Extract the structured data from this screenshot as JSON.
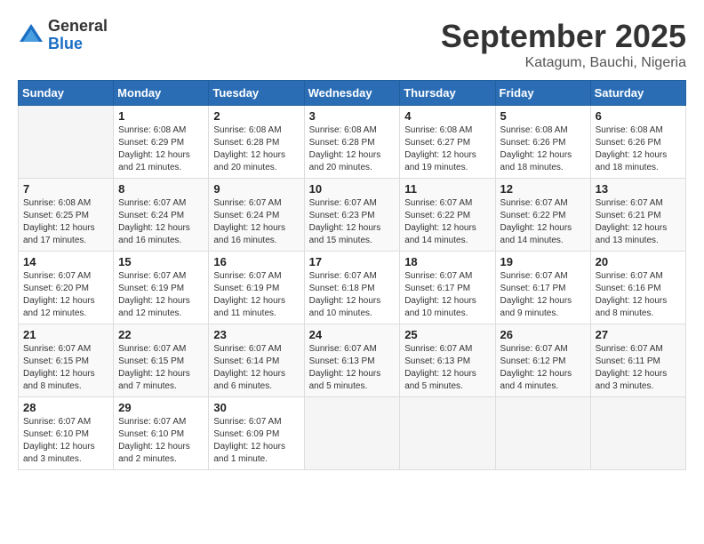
{
  "logo": {
    "general": "General",
    "blue": "Blue"
  },
  "header": {
    "month_title": "September 2025",
    "location": "Katagum, Bauchi, Nigeria"
  },
  "days_of_week": [
    "Sunday",
    "Monday",
    "Tuesday",
    "Wednesday",
    "Thursday",
    "Friday",
    "Saturday"
  ],
  "weeks": [
    [
      {
        "day": "",
        "sunrise": "",
        "sunset": "",
        "daylight": ""
      },
      {
        "day": "1",
        "sunrise": "Sunrise: 6:08 AM",
        "sunset": "Sunset: 6:29 PM",
        "daylight": "Daylight: 12 hours and 21 minutes."
      },
      {
        "day": "2",
        "sunrise": "Sunrise: 6:08 AM",
        "sunset": "Sunset: 6:28 PM",
        "daylight": "Daylight: 12 hours and 20 minutes."
      },
      {
        "day": "3",
        "sunrise": "Sunrise: 6:08 AM",
        "sunset": "Sunset: 6:28 PM",
        "daylight": "Daylight: 12 hours and 20 minutes."
      },
      {
        "day": "4",
        "sunrise": "Sunrise: 6:08 AM",
        "sunset": "Sunset: 6:27 PM",
        "daylight": "Daylight: 12 hours and 19 minutes."
      },
      {
        "day": "5",
        "sunrise": "Sunrise: 6:08 AM",
        "sunset": "Sunset: 6:26 PM",
        "daylight": "Daylight: 12 hours and 18 minutes."
      },
      {
        "day": "6",
        "sunrise": "Sunrise: 6:08 AM",
        "sunset": "Sunset: 6:26 PM",
        "daylight": "Daylight: 12 hours and 18 minutes."
      }
    ],
    [
      {
        "day": "7",
        "sunrise": "Sunrise: 6:08 AM",
        "sunset": "Sunset: 6:25 PM",
        "daylight": "Daylight: 12 hours and 17 minutes."
      },
      {
        "day": "8",
        "sunrise": "Sunrise: 6:07 AM",
        "sunset": "Sunset: 6:24 PM",
        "daylight": "Daylight: 12 hours and 16 minutes."
      },
      {
        "day": "9",
        "sunrise": "Sunrise: 6:07 AM",
        "sunset": "Sunset: 6:24 PM",
        "daylight": "Daylight: 12 hours and 16 minutes."
      },
      {
        "day": "10",
        "sunrise": "Sunrise: 6:07 AM",
        "sunset": "Sunset: 6:23 PM",
        "daylight": "Daylight: 12 hours and 15 minutes."
      },
      {
        "day": "11",
        "sunrise": "Sunrise: 6:07 AM",
        "sunset": "Sunset: 6:22 PM",
        "daylight": "Daylight: 12 hours and 14 minutes."
      },
      {
        "day": "12",
        "sunrise": "Sunrise: 6:07 AM",
        "sunset": "Sunset: 6:22 PM",
        "daylight": "Daylight: 12 hours and 14 minutes."
      },
      {
        "day": "13",
        "sunrise": "Sunrise: 6:07 AM",
        "sunset": "Sunset: 6:21 PM",
        "daylight": "Daylight: 12 hours and 13 minutes."
      }
    ],
    [
      {
        "day": "14",
        "sunrise": "Sunrise: 6:07 AM",
        "sunset": "Sunset: 6:20 PM",
        "daylight": "Daylight: 12 hours and 12 minutes."
      },
      {
        "day": "15",
        "sunrise": "Sunrise: 6:07 AM",
        "sunset": "Sunset: 6:19 PM",
        "daylight": "Daylight: 12 hours and 12 minutes."
      },
      {
        "day": "16",
        "sunrise": "Sunrise: 6:07 AM",
        "sunset": "Sunset: 6:19 PM",
        "daylight": "Daylight: 12 hours and 11 minutes."
      },
      {
        "day": "17",
        "sunrise": "Sunrise: 6:07 AM",
        "sunset": "Sunset: 6:18 PM",
        "daylight": "Daylight: 12 hours and 10 minutes."
      },
      {
        "day": "18",
        "sunrise": "Sunrise: 6:07 AM",
        "sunset": "Sunset: 6:17 PM",
        "daylight": "Daylight: 12 hours and 10 minutes."
      },
      {
        "day": "19",
        "sunrise": "Sunrise: 6:07 AM",
        "sunset": "Sunset: 6:17 PM",
        "daylight": "Daylight: 12 hours and 9 minutes."
      },
      {
        "day": "20",
        "sunrise": "Sunrise: 6:07 AM",
        "sunset": "Sunset: 6:16 PM",
        "daylight": "Daylight: 12 hours and 8 minutes."
      }
    ],
    [
      {
        "day": "21",
        "sunrise": "Sunrise: 6:07 AM",
        "sunset": "Sunset: 6:15 PM",
        "daylight": "Daylight: 12 hours and 8 minutes."
      },
      {
        "day": "22",
        "sunrise": "Sunrise: 6:07 AM",
        "sunset": "Sunset: 6:15 PM",
        "daylight": "Daylight: 12 hours and 7 minutes."
      },
      {
        "day": "23",
        "sunrise": "Sunrise: 6:07 AM",
        "sunset": "Sunset: 6:14 PM",
        "daylight": "Daylight: 12 hours and 6 minutes."
      },
      {
        "day": "24",
        "sunrise": "Sunrise: 6:07 AM",
        "sunset": "Sunset: 6:13 PM",
        "daylight": "Daylight: 12 hours and 5 minutes."
      },
      {
        "day": "25",
        "sunrise": "Sunrise: 6:07 AM",
        "sunset": "Sunset: 6:13 PM",
        "daylight": "Daylight: 12 hours and 5 minutes."
      },
      {
        "day": "26",
        "sunrise": "Sunrise: 6:07 AM",
        "sunset": "Sunset: 6:12 PM",
        "daylight": "Daylight: 12 hours and 4 minutes."
      },
      {
        "day": "27",
        "sunrise": "Sunrise: 6:07 AM",
        "sunset": "Sunset: 6:11 PM",
        "daylight": "Daylight: 12 hours and 3 minutes."
      }
    ],
    [
      {
        "day": "28",
        "sunrise": "Sunrise: 6:07 AM",
        "sunset": "Sunset: 6:10 PM",
        "daylight": "Daylight: 12 hours and 3 minutes."
      },
      {
        "day": "29",
        "sunrise": "Sunrise: 6:07 AM",
        "sunset": "Sunset: 6:10 PM",
        "daylight": "Daylight: 12 hours and 2 minutes."
      },
      {
        "day": "30",
        "sunrise": "Sunrise: 6:07 AM",
        "sunset": "Sunset: 6:09 PM",
        "daylight": "Daylight: 12 hours and 1 minute."
      },
      {
        "day": "",
        "sunrise": "",
        "sunset": "",
        "daylight": ""
      },
      {
        "day": "",
        "sunrise": "",
        "sunset": "",
        "daylight": ""
      },
      {
        "day": "",
        "sunrise": "",
        "sunset": "",
        "daylight": ""
      },
      {
        "day": "",
        "sunrise": "",
        "sunset": "",
        "daylight": ""
      }
    ]
  ]
}
